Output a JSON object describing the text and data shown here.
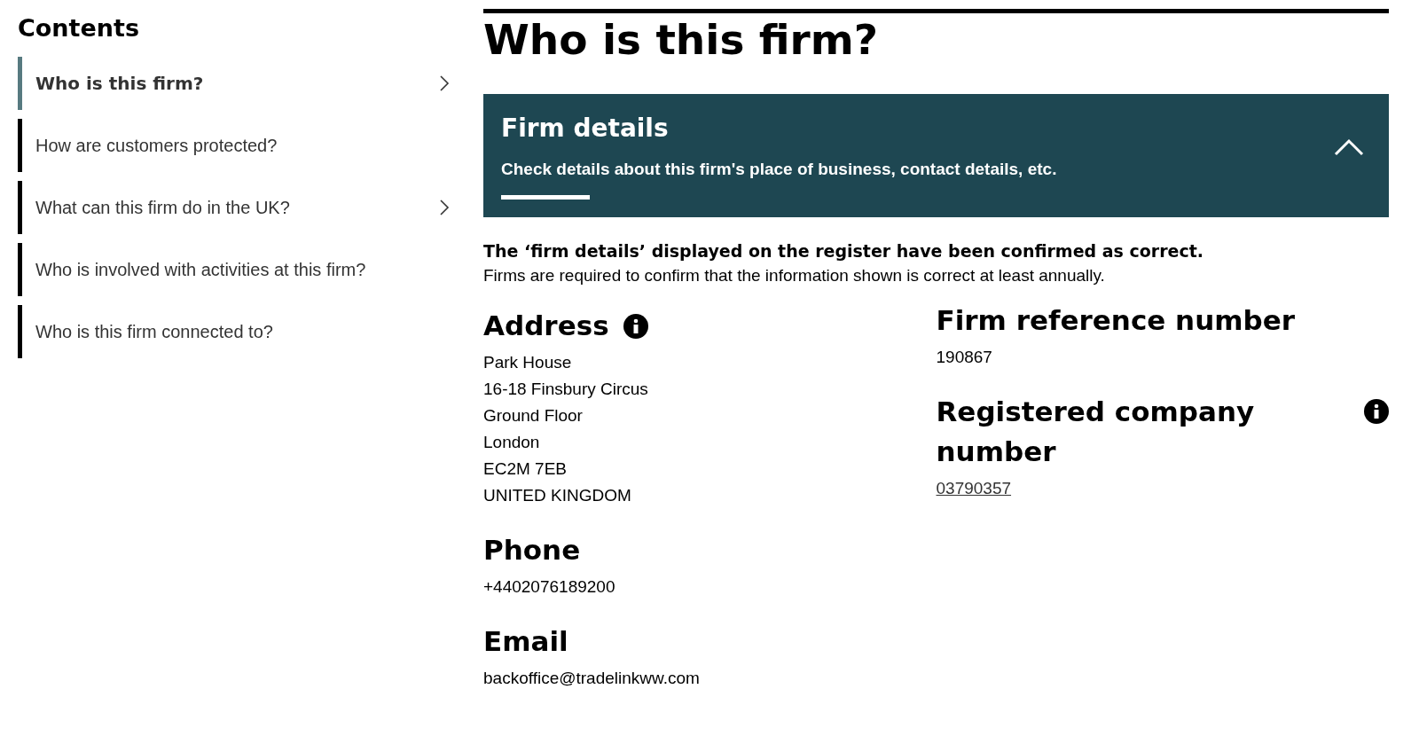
{
  "contents": {
    "title": "Contents",
    "items": [
      {
        "label": "Who is this firm?",
        "selected": true,
        "has_submenu": true
      },
      {
        "label": "How are customers protected?",
        "selected": false,
        "has_submenu": false
      },
      {
        "label": "What can this firm do in the UK?",
        "selected": false,
        "has_submenu": true
      },
      {
        "label": "Who is involved with activities at this firm?",
        "selected": false,
        "has_submenu": false
      },
      {
        "label": "Who is this firm connected to?",
        "selected": false,
        "has_submenu": false
      }
    ]
  },
  "page_title": "Who is this firm?",
  "panel": {
    "title": "Firm details",
    "description": "Check details about this firm's place of business, contact details, etc.",
    "expanded": true
  },
  "confirmation": {
    "heading": "The ‘firm details’ displayed on the register have been confirmed as correct.",
    "note": "Firms are required to confirm that the information shown is correct at least annually."
  },
  "left_fields": [
    {
      "label": "Address",
      "info": true,
      "kind": "lines",
      "lines": [
        "Park House",
        "16-18 Finsbury Circus",
        "Ground Floor",
        "London",
        "EC2M 7EB",
        "UNITED KINGDOM"
      ]
    },
    {
      "label": "Phone",
      "info": false,
      "kind": "lines",
      "lines": [
        "+4402076189200"
      ]
    },
    {
      "label": "Email",
      "info": false,
      "kind": "lines",
      "lines": [
        "backoffice@tradelinkww.com"
      ]
    }
  ],
  "right_fields": [
    {
      "label": "Firm reference number",
      "info": false,
      "kind": "lines",
      "lines": [
        "190867"
      ]
    },
    {
      "label": "Registered company number",
      "info": true,
      "kind": "link",
      "lines": [
        "03790357"
      ]
    }
  ]
}
